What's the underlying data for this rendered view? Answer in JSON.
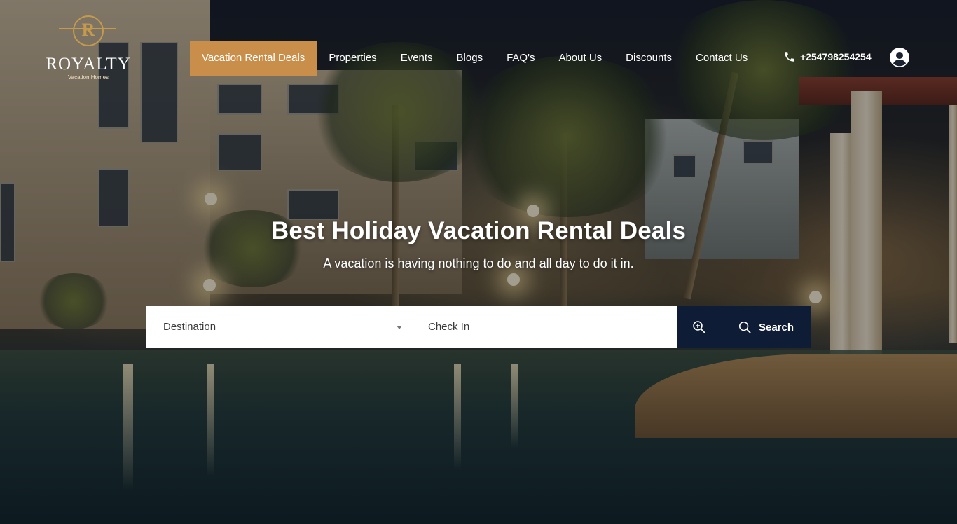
{
  "brand": {
    "crest_letter": "R",
    "name": "ROYALTY",
    "tagline": "Vacation Homes",
    "accent": "#c98f4a"
  },
  "nav": {
    "items": [
      {
        "label": "Vacation Rental Deals",
        "active": true
      },
      {
        "label": "Properties"
      },
      {
        "label": "Events"
      },
      {
        "label": "Blogs"
      },
      {
        "label": "FAQ's"
      },
      {
        "label": "About Us"
      },
      {
        "label": "Discounts"
      },
      {
        "label": "Contact Us"
      }
    ],
    "phone": "+254798254254",
    "phone_icon": "phone-icon",
    "account_icon": "user-account-icon"
  },
  "hero": {
    "title": "Best Holiday Vacation Rental Deals",
    "subtitle": "A vacation is having nothing to do and all day to do it in."
  },
  "search": {
    "destination_placeholder": "Destination",
    "checkin_placeholder": "Check In",
    "zoom_icon": "zoom-in-icon",
    "button_label": "Search",
    "button_color": "#0f1c35"
  }
}
